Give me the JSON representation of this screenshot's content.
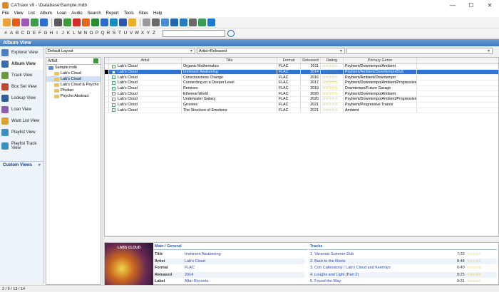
{
  "window": {
    "title": "CATraxx v9 - \\Database\\Sample.mdb",
    "min": "—",
    "max": "☐",
    "close": "✕"
  },
  "menu": [
    "File",
    "View",
    "List",
    "Album",
    "Loan",
    "Audio",
    "Search",
    "Report",
    "Tools",
    "Sites",
    "Help"
  ],
  "alphabet": [
    "#",
    "A",
    "B",
    "C",
    "D",
    "E",
    "F",
    "G",
    "H",
    "I",
    "J",
    "K",
    "L",
    "M",
    "N",
    "O",
    "P",
    "Q",
    "R",
    "S",
    "T",
    "U",
    "V",
    "W",
    "X",
    "Y",
    "Z"
  ],
  "search": {
    "value": ""
  },
  "panel": {
    "title": "Album View"
  },
  "nav": [
    {
      "label": "Explorer View",
      "icon": "explorer-icon",
      "color": "#4a7fc0"
    },
    {
      "label": "Album View",
      "icon": "album-icon",
      "color": "#3c6ab0",
      "active": true
    },
    {
      "label": "Track View",
      "icon": "track-icon",
      "color": "#6a9a3c"
    },
    {
      "label": "Box Set View",
      "icon": "boxset-icon",
      "color": "#c0482e"
    },
    {
      "label": "Lookup View",
      "icon": "lookup-icon",
      "color": "#2f5d9e"
    },
    {
      "label": "Loan View",
      "icon": "loan-icon",
      "color": "#8a5ea8"
    },
    {
      "label": "Want List View",
      "icon": "wantlist-icon",
      "color": "#e0a030"
    },
    {
      "label": "Playlist View",
      "icon": "playlist-icon",
      "color": "#3a8fbf"
    },
    {
      "label": "Playlist Track View",
      "icon": "playlist-track-icon",
      "color": "#3a8fbf"
    }
  ],
  "custom_views": {
    "label": "Custom Views",
    "arrow": "»"
  },
  "layout": {
    "value": "Default Layout",
    "sort": "Artist+Released",
    "filter": ""
  },
  "tree": {
    "field": "Artist",
    "items": [
      {
        "label": "Sample.mdb",
        "level": 0
      },
      {
        "label": "Lab's Cloud",
        "level": 1
      },
      {
        "label": "Lab's Cloud",
        "level": 1,
        "selected": true
      },
      {
        "label": "Lab's Cloud & Psycho",
        "level": 1
      },
      {
        "label": "Phelian",
        "level": 1
      },
      {
        "label": "Psycho Abstract",
        "level": 1
      }
    ]
  },
  "table": {
    "columns": [
      "Artist",
      "Title",
      "Format",
      "Released",
      "Rating",
      "Primary Genre"
    ],
    "rows": [
      {
        "artist": "Lab's Cloud",
        "title": "Organic Mathematics",
        "format": "FLAC",
        "released": "2011",
        "genre": "Psybient/Downtempo/Ambient"
      },
      {
        "artist": "Lab's Cloud",
        "title": "Imminent Awakening",
        "format": "FLAC",
        "released": "2014",
        "genre": "Psybient/Ambient/Downtempo/Dub",
        "selected": true
      },
      {
        "artist": "Lab's Cloud",
        "title": "Consciousness Change",
        "format": "FLAC",
        "released": "2016",
        "genre": "Psybient/Ambient/Downtempo"
      },
      {
        "artist": "Lab's Cloud",
        "title": "Connecting on a Deeper Level",
        "format": "FLAC",
        "released": "2017",
        "genre": "Psybient/Downtempo/Ambient/Progressive Tr"
      },
      {
        "artist": "Lab's Cloud",
        "title": "Remixes",
        "format": "FLAC",
        "released": "2019",
        "genre": "Downtempo/Future Garage"
      },
      {
        "artist": "Lab's Cloud",
        "title": "Ethereal World",
        "format": "FLAC",
        "released": "2020",
        "genre": "Psybient/Downtempo/Ambient"
      },
      {
        "artist": "Lab's Cloud",
        "title": "Underwater Galaxy",
        "format": "FLAC",
        "released": "2020",
        "genre": "Psybient/Downtempo/Ambient/Progressive Tr"
      },
      {
        "artist": "Lab's Cloud",
        "title": "Grooves",
        "format": "FLAC",
        "released": "2021",
        "genre": "Psybient/Progressive Trance"
      },
      {
        "artist": "Lab's Cloud",
        "title": "The Structure of Emotions",
        "format": "FLAC",
        "released": "2021",
        "genre": "Ambient"
      }
    ],
    "stars": "☆☆☆☆☆"
  },
  "detail": {
    "cover_text": "LABS CLOUD",
    "header": "Main / General",
    "fields": [
      {
        "k": "Title",
        "v": "Imminent Awakening"
      },
      {
        "k": "Artist",
        "v": "Lab's Cloud"
      },
      {
        "k": "Format",
        "v": "FLAC"
      },
      {
        "k": "Released",
        "v": "2014"
      },
      {
        "k": "Label",
        "v": "Altar Records"
      }
    ]
  },
  "tracks": {
    "header": "Tracks",
    "items": [
      {
        "name": "1. Varanasi Summer Dub",
        "len": "7:33"
      },
      {
        "name": "2. Back to the Roots",
        "len": "8:48"
      },
      {
        "name": "3. Con Cafeostony / Lab's Cloud and Keemiyo",
        "len": "6:40"
      },
      {
        "name": "4. Loughs and Light (Part 2)",
        "len": "8:25"
      },
      {
        "name": "5. Found the Way",
        "len": "9:31"
      }
    ],
    "stars": "☆☆☆☆☆"
  },
  "status": {
    "text": "2 / 9 / 13 / 14"
  },
  "toolbar_colors": [
    "#e8a23a",
    "#e65a1a",
    "#9b59b6",
    "#3c9c4a",
    "#2e6fd0",
    "#5a5a5a",
    "#3a9a3a",
    "#d62a2a",
    "#e06a1a",
    "#2a8a3a",
    "#2a6ad0",
    "#1a8ac0",
    "#2a5ab0",
    "#e8b02a",
    "#9a9a9a",
    "#6a6a6a",
    "#4a8ad0",
    "#1a6ab0",
    "#2a7ac0",
    "#6a6a6a",
    "#3a9a5a",
    "#1a7ad0"
  ]
}
